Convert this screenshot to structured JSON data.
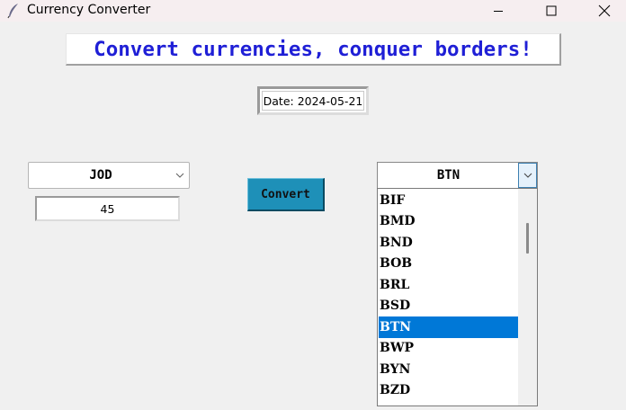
{
  "window": {
    "title": "Currency Converter",
    "icon": "feather-icon",
    "controls": [
      "minimize-icon",
      "maximize-icon",
      "close-icon"
    ]
  },
  "heading": "Convert currencies, conquer borders!",
  "date_label": "Date: 2024-05-21",
  "from_currency": {
    "selected": "JOD",
    "icon": "chevron-down-icon"
  },
  "amount": "45",
  "convert_button": "Convert",
  "to_currency": {
    "selected": "BTN",
    "icon": "chevron-down-icon",
    "options": [
      "BIF",
      "BMD",
      "BND",
      "BOB",
      "BRL",
      "BSD",
      "BTN",
      "BWP",
      "BYN",
      "BZD"
    ],
    "highlighted": "BTN"
  },
  "colors": {
    "heading_text": "#1f1fd6",
    "convert_button_bg": "#1e90b8",
    "selection_bg": "#0078d7"
  }
}
